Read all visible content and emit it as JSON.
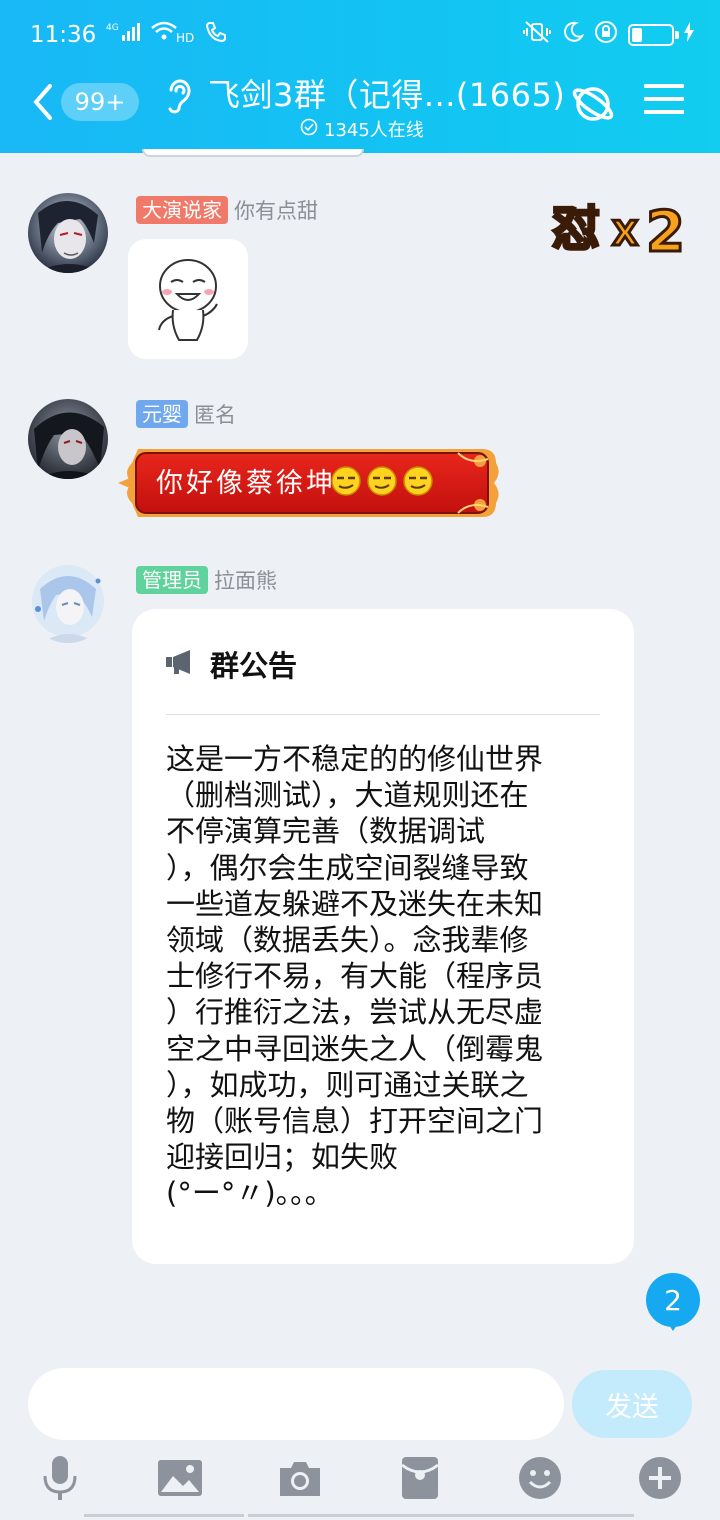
{
  "status_bar": {
    "time": "11:36",
    "network": "4G",
    "hd": "HD",
    "battery_level": 0.25
  },
  "header": {
    "unread_count": "99+",
    "title": "飞剑3群（记得...(1665)",
    "online_text": "1345人在线",
    "icons": [
      "back-icon",
      "ear-icon",
      "planet-icon",
      "menu-icon"
    ]
  },
  "badge": {
    "text": "怼",
    "multiplier": "X",
    "count": "2"
  },
  "messages": [
    {
      "tag": "大演说家",
      "tag_color": "#f0796a",
      "name": "你有点甜",
      "type": "sticker"
    },
    {
      "tag": "元婴",
      "tag_color": "#6fa8ee",
      "name": "匿名",
      "type": "text",
      "text": "你好像蔡徐坤"
    },
    {
      "tag": "管理员",
      "tag_color": "#5fd39b",
      "name": "拉面熊",
      "type": "announcement",
      "card_title": "群公告",
      "card_lines": [
        "这是一方不稳定的的修仙世界",
        "（删档测试），大道规则还在",
        "不停演算完善（数据调试",
        "），偶尔会生成空间裂缝导致",
        "一些道友躲避不及迷失在未知",
        "领域（数据丢失）。念我辈修",
        "士修行不易，有大能（程序员",
        "）行推衍之法，尝试从无尽虚",
        "空之中寻回迷失之人（倒霉鬼",
        "），如成功，则可通过关联之",
        "物（账号信息）打开空间之门",
        "迎接回归；如失败",
        "(°ー°〃)。。。"
      ]
    }
  ],
  "new_message_count": "2",
  "input": {
    "value": "",
    "send_label": "发送"
  },
  "toolbar": [
    "mic-icon",
    "image-icon",
    "camera-icon",
    "red-packet-icon",
    "emoji-icon",
    "plus-icon"
  ]
}
